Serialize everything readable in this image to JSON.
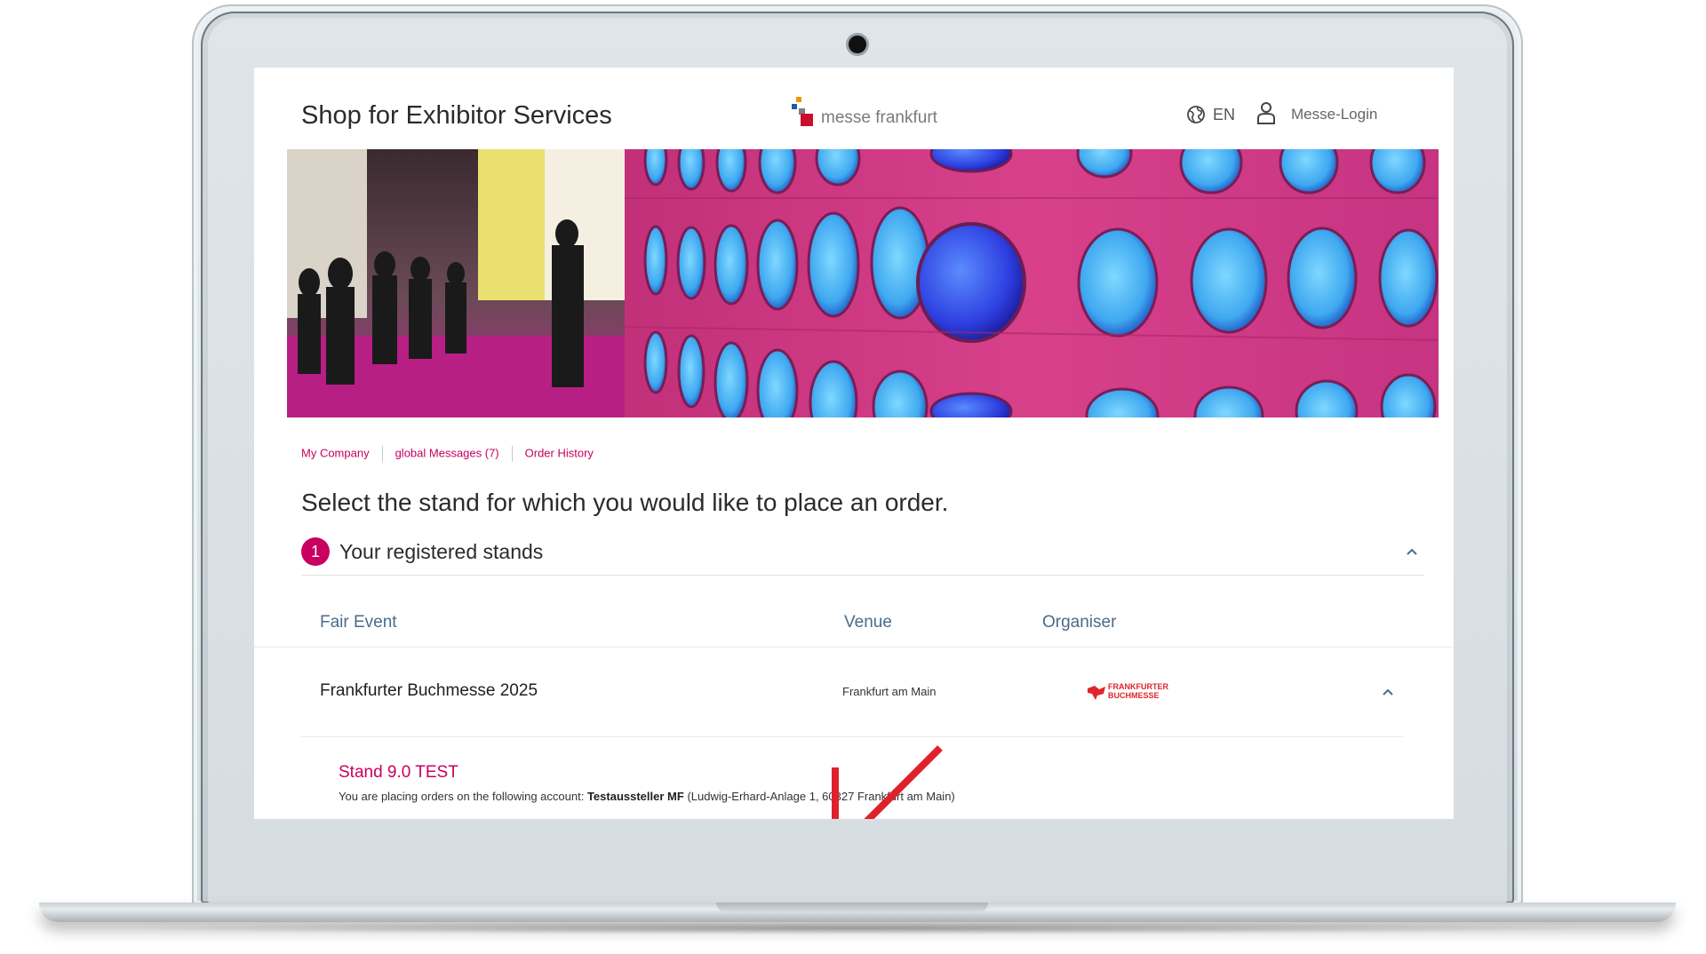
{
  "header": {
    "title": "Shop for Exhibitor Services",
    "logo_text": "messe frankfurt",
    "language": "EN",
    "login_label": "Messe-Login"
  },
  "subnav": {
    "items": [
      {
        "label": "My Company"
      },
      {
        "label": "global Messages (7)"
      },
      {
        "label": "Order History"
      }
    ]
  },
  "main": {
    "heading": "Select the stand for which you would like to place an order.",
    "step": {
      "number": "1",
      "label": "Your registered stands"
    },
    "table": {
      "columns": [
        "Fair Event",
        "Venue",
        "Organiser"
      ],
      "rows": [
        {
          "event": "Frankfurter Buchmesse 2025",
          "venue": "Frankfurt am Main",
          "organiser_line1": "FRANKFURTER",
          "organiser_line2": "BUCHMESSE"
        }
      ]
    },
    "stand": {
      "label": "Stand 9.0 TEST",
      "account_prefix": "You are placing orders on the following account:",
      "account_name": "Testaussteller MF",
      "account_address": "(Ludwig-Erhard-Anlage 1, 60327 Frankfurt am Main)"
    }
  },
  "colors": {
    "accent": "#c8005f",
    "table_header": "#4a6b8a",
    "arrow": "#e0202a",
    "organiser_red": "#e0262c"
  },
  "icons": [
    "globe-icon",
    "user-icon",
    "chevron-up-icon",
    "arrow-down-left-icon"
  ]
}
